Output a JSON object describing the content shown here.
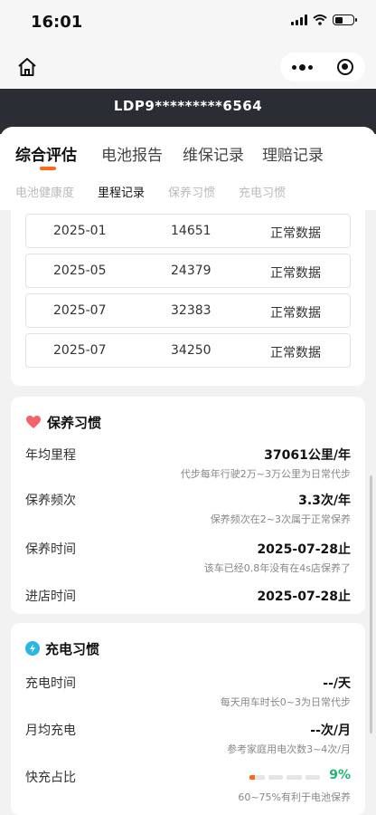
{
  "status": {
    "time": "16:01"
  },
  "plate": "LDP9*********6564",
  "main_tabs": [
    {
      "label": "综合评估"
    },
    {
      "label": "电池报告"
    },
    {
      "label": "维保记录"
    },
    {
      "label": "理赔记录"
    }
  ],
  "sub_tabs": [
    {
      "label": "电池健康度"
    },
    {
      "label": "里程记录"
    },
    {
      "label": "保养习惯"
    },
    {
      "label": "充电习惯"
    }
  ],
  "mileage_rows": [
    {
      "date": "2025-01",
      "km": "14651",
      "status": "正常数据"
    },
    {
      "date": "2025-05",
      "km": "24379",
      "status": "正常数据"
    },
    {
      "date": "2025-07",
      "km": "32383",
      "status": "正常数据"
    },
    {
      "date": "2025-07",
      "km": "34250",
      "status": "正常数据"
    }
  ],
  "maintenance": {
    "title": "保养习惯",
    "icon": "heart-icon",
    "rows": [
      {
        "label": "年均里程",
        "value": "37061公里/年",
        "note": "代步每年行驶2万~3万公里为日常代步"
      },
      {
        "label": "保养频次",
        "value": "3.3次/年",
        "note": "保养频次在2~3次属于正常保养"
      },
      {
        "label": "保养时间",
        "value": "2025-07-28止",
        "note": "该车已经0.8年没有在4s店保养了"
      },
      {
        "label": "进店时间",
        "value": "2025-07-28止",
        "note": ""
      }
    ]
  },
  "charging": {
    "title": "充电习惯",
    "icon": "lightning-icon",
    "rows": [
      {
        "label": "充电时间",
        "value": "--/天",
        "note": "每天用车时长0~3为日常代步"
      },
      {
        "label": "月均充电",
        "value": "--次/月",
        "note": "参考家庭用电次数3~4次/月"
      }
    ],
    "fast_charge": {
      "label": "快充占比",
      "percent": "9%",
      "fraction": 0.09,
      "note": "60~75%有利于电池保养"
    }
  },
  "colors": {
    "accent": "#ff6a1a",
    "green": "#22b573",
    "header": "#2a2d33"
  }
}
